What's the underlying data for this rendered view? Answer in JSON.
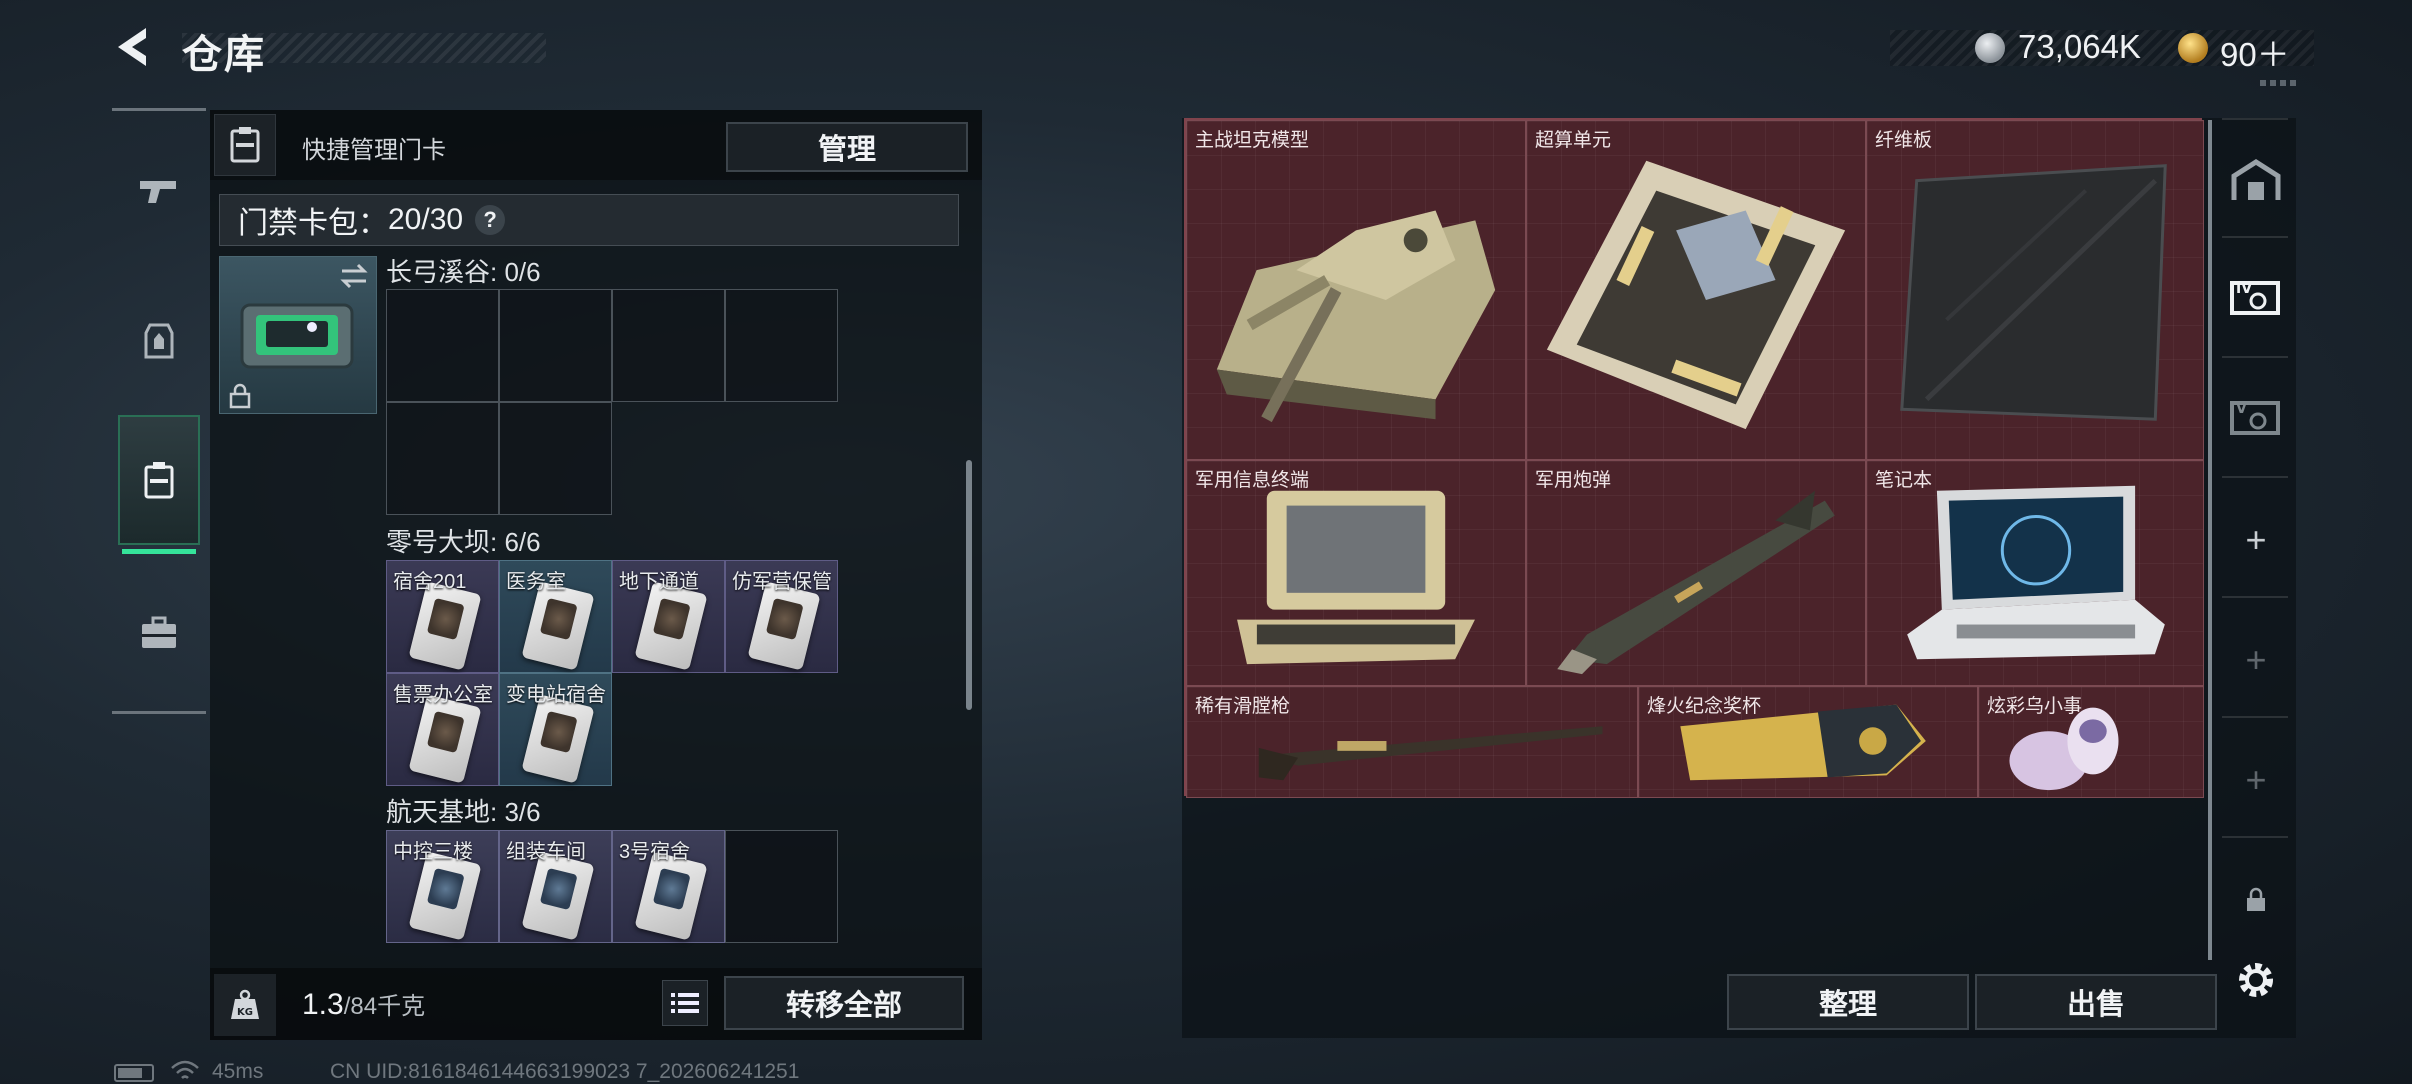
{
  "header": {
    "title": "仓库"
  },
  "currency": {
    "silver": "73,064K",
    "gold": "90＋"
  },
  "quick_manage": {
    "label": "快捷管理门卡",
    "manage_button": "管理",
    "card_bag_label": "门禁卡包：",
    "card_bag_count": "20/30",
    "help": "?"
  },
  "sections": [
    {
      "title": "长弓溪谷: 0/6",
      "cells": []
    },
    {
      "title": "零号大坝: 6/6",
      "cells": [
        {
          "name": "宿舍201"
        },
        {
          "name": "医务室"
        },
        {
          "name": "地下通道"
        },
        {
          "name": "仿军营保管"
        },
        {
          "name": "售票办公室"
        },
        {
          "name": "变电站宿舍"
        }
      ]
    },
    {
      "title": "航天基地: 3/6",
      "cells": [
        {
          "name": "中控三楼"
        },
        {
          "name": "组装车间"
        },
        {
          "name": "3号宿舍"
        }
      ]
    }
  ],
  "footer": {
    "weight_current": "1.3",
    "weight_max": "/84千克",
    "transfer_all": "转移全部"
  },
  "items": [
    {
      "name": "主战坦克模型",
      "icon": "tank-model-icon"
    },
    {
      "name": "超算单元",
      "icon": "supercomputer-unit-icon"
    },
    {
      "name": "纤维板",
      "icon": "fiber-board-icon"
    },
    {
      "name": "军用信息终端",
      "icon": "military-terminal-icon"
    },
    {
      "name": "军用炮弹",
      "icon": "artillery-shell-icon"
    },
    {
      "name": "笔记本",
      "icon": "laptop-icon"
    },
    {
      "name": "稀有滑膛枪",
      "icon": "musket-icon"
    },
    {
      "name": "烽火纪念奖杯",
      "icon": "trophy-icon"
    },
    {
      "name": "炫彩乌小事",
      "icon": "figurine-icon"
    }
  ],
  "actions": {
    "sort": "整理",
    "sell": "出售"
  },
  "status": {
    "ping": "45ms",
    "uid": "CN UID:8161846144663199023 7_202606241251"
  },
  "colors": {
    "accent": "#35e39a",
    "item_bg": "#4a232a"
  }
}
